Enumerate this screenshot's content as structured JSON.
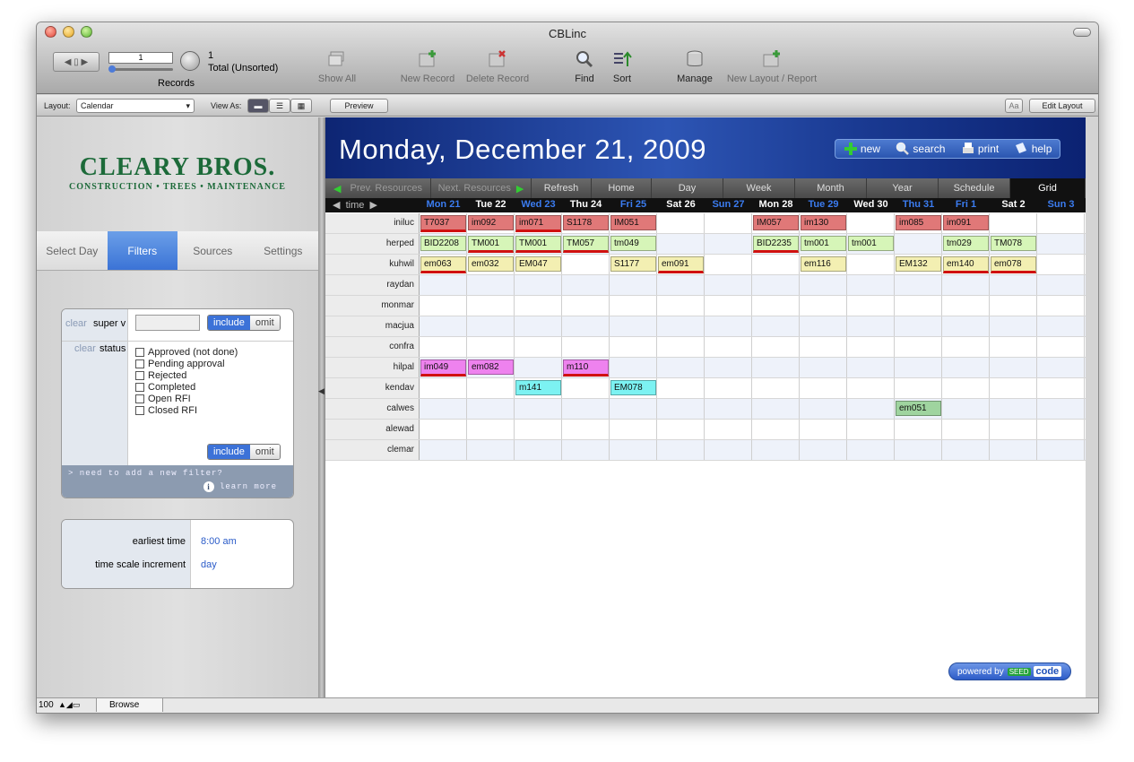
{
  "window": {
    "title": "CBLinc"
  },
  "toolbar": {
    "record_value": "1",
    "records_label": "Records",
    "found_count": "1",
    "found_status": "Total (Unsorted)",
    "show_all": "Show All",
    "new_record": "New Record",
    "delete_record": "Delete Record",
    "find": "Find",
    "sort": "Sort",
    "manage": "Manage",
    "new_layout": "New Layout / Report"
  },
  "layoutbar": {
    "layout_label": "Layout:",
    "layout_value": "Calendar",
    "view_as_label": "View As:",
    "preview": "Preview",
    "aa": "Aa",
    "edit_layout": "Edit Layout"
  },
  "sidebar": {
    "logo_name": "CLEARY BROS.",
    "logo_tagline": "CONSTRUCTION • TREES • MAINTENANCE",
    "tabs": [
      "Select Day",
      "Filters",
      "Sources",
      "Settings"
    ],
    "filters": {
      "clear": "clear",
      "super_label": "super v",
      "status_label": "status",
      "include": "include",
      "omit": "omit",
      "statuses": [
        "Approved (not done)",
        "Pending approval",
        "Rejected",
        "Completed",
        "Open RFI",
        "Closed RFI"
      ],
      "footer_line1": "> need to add a new filter?",
      "footer_line2": "learn more"
    },
    "settings": {
      "earliest_label": "earliest time",
      "earliest_value": "8:00 am",
      "increment_label": "time scale increment",
      "increment_value": "day"
    }
  },
  "status": {
    "zoom": "100",
    "mode": "Browse"
  },
  "calendar": {
    "date_title": "Monday, December 21, 2009",
    "header_buttons": [
      "new",
      "search",
      "print",
      "help"
    ],
    "nav": [
      "Prev. Resources",
      "Next. Resources",
      "Refresh",
      "Home",
      "Day",
      "Week",
      "Month",
      "Year",
      "Schedule",
      "Grid"
    ],
    "time_label": "time",
    "days": [
      "Mon 21",
      "Tue 22",
      "Wed 23",
      "Thu 24",
      "Fri 25",
      "Sat 26",
      "Sun 27",
      "Mon 28",
      "Tue 29",
      "Wed 30",
      "Thu 31",
      "Fri 1",
      "Sat 2",
      "Sun 3"
    ],
    "day_colors": [
      "#3b7cf0",
      "#ffffff",
      "#3b7cf0",
      "#ffffff",
      "#3b7cf0",
      "#ffffff",
      "#3b7cf0",
      "#ffffff",
      "#3b7cf0",
      "#ffffff",
      "#3b7cf0",
      "#3b7cf0",
      "#ffffff",
      "#3b7cf0"
    ],
    "resources": [
      "iniluc",
      "herped",
      "kuhwil",
      "raydan",
      "monmar",
      "macjua",
      "confra",
      "hilpal",
      "kendav",
      "calwes",
      "alewad",
      "clemar"
    ],
    "events": [
      {
        "res": 0,
        "day": 0,
        "label": "T7037",
        "color": "#e07878",
        "mark": true
      },
      {
        "res": 0,
        "day": 1,
        "label": "im092",
        "color": "#e07878",
        "mark": false
      },
      {
        "res": 0,
        "day": 2,
        "label": "im071",
        "color": "#e07878",
        "mark": true
      },
      {
        "res": 0,
        "day": 3,
        "label": "S1178",
        "color": "#e07878",
        "mark": false
      },
      {
        "res": 0,
        "day": 4,
        "label": "IM051",
        "color": "#e07878",
        "mark": false
      },
      {
        "res": 0,
        "day": 7,
        "label": "IM057",
        "color": "#e07878",
        "mark": false
      },
      {
        "res": 0,
        "day": 8,
        "label": "im130",
        "color": "#e07878",
        "mark": false
      },
      {
        "res": 0,
        "day": 10,
        "label": "im085",
        "color": "#e07878",
        "mark": false
      },
      {
        "res": 0,
        "day": 11,
        "label": "im091",
        "color": "#e07878",
        "mark": false
      },
      {
        "res": 1,
        "day": 0,
        "label": "BID2208",
        "color": "#d6f5b8",
        "mark": false
      },
      {
        "res": 1,
        "day": 1,
        "label": "TM001",
        "color": "#d6f5b8",
        "mark": true
      },
      {
        "res": 1,
        "day": 2,
        "label": "TM001",
        "color": "#d6f5b8",
        "mark": true
      },
      {
        "res": 1,
        "day": 3,
        "label": "TM057",
        "color": "#d6f5b8",
        "mark": true
      },
      {
        "res": 1,
        "day": 4,
        "label": "tm049",
        "color": "#d6f5b8",
        "mark": false
      },
      {
        "res": 1,
        "day": 7,
        "label": "BID2235",
        "color": "#d6f5b8",
        "mark": true
      },
      {
        "res": 1,
        "day": 8,
        "label": "tm001",
        "color": "#d6f5b8",
        "mark": false
      },
      {
        "res": 1,
        "day": 9,
        "label": "tm001",
        "color": "#d6f5b8",
        "mark": false
      },
      {
        "res": 1,
        "day": 11,
        "label": "tm029",
        "color": "#d6f5b8",
        "mark": false
      },
      {
        "res": 1,
        "day": 12,
        "label": "TM078",
        "color": "#d6f5b8",
        "mark": false
      },
      {
        "res": 2,
        "day": 0,
        "label": "em063",
        "color": "#f3efb2",
        "mark": true
      },
      {
        "res": 2,
        "day": 1,
        "label": "em032",
        "color": "#f3efb2",
        "mark": false
      },
      {
        "res": 2,
        "day": 2,
        "label": "EM047",
        "color": "#f3efb2",
        "mark": false
      },
      {
        "res": 2,
        "day": 4,
        "label": "S1177",
        "color": "#f3efb2",
        "mark": false
      },
      {
        "res": 2,
        "day": 5,
        "label": "em091",
        "color": "#f3efb2",
        "mark": true
      },
      {
        "res": 2,
        "day": 8,
        "label": "em116",
        "color": "#f3efb2",
        "mark": false
      },
      {
        "res": 2,
        "day": 10,
        "label": "EM132",
        "color": "#f3efb2",
        "mark": false
      },
      {
        "res": 2,
        "day": 11,
        "label": "em140",
        "color": "#f3efb2",
        "mark": true
      },
      {
        "res": 2,
        "day": 12,
        "label": "em078",
        "color": "#f3efb2",
        "mark": true
      },
      {
        "res": 7,
        "day": 0,
        "label": "im049",
        "color": "#ee82ee",
        "mark": true
      },
      {
        "res": 7,
        "day": 1,
        "label": "em082",
        "color": "#ee82ee",
        "mark": false
      },
      {
        "res": 7,
        "day": 3,
        "label": "m110",
        "color": "#ee82ee",
        "mark": true
      },
      {
        "res": 8,
        "day": 2,
        "label": "m141",
        "color": "#7cf2f2",
        "mark": false
      },
      {
        "res": 8,
        "day": 4,
        "label": "EM078",
        "color": "#7cf2f2",
        "mark": false
      },
      {
        "res": 9,
        "day": 10,
        "label": "em051",
        "color": "#9fd49f",
        "mark": false
      }
    ],
    "powered_by": "powered by",
    "powered_brand": "SEED",
    "powered_brand2": "code"
  }
}
